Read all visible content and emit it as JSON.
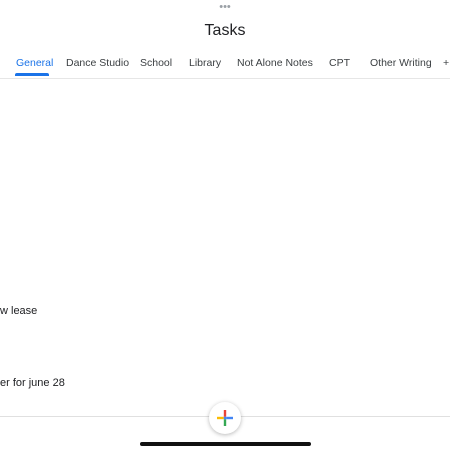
{
  "header": {
    "dots": "•••",
    "title": "Tasks"
  },
  "tabs": [
    {
      "label": "General",
      "active": true
    },
    {
      "label": "Dance Studio",
      "active": false
    },
    {
      "label": "School",
      "active": false
    },
    {
      "label": "Library",
      "active": false
    },
    {
      "label": "Not Alone Notes",
      "active": false
    },
    {
      "label": "CPT",
      "active": false
    },
    {
      "label": "Other Writing",
      "active": false
    },
    {
      "label": "+",
      "active": false
    }
  ],
  "tasks": [
    {
      "text": "w lease"
    },
    {
      "text": "er for june 28"
    }
  ],
  "fab": {
    "icon": "plus-icon",
    "colors": {
      "blue": "#4285F4",
      "red": "#EA4335",
      "yellow": "#FBBC04",
      "green": "#34A853"
    }
  },
  "colors": {
    "accent": "#1a73e8"
  }
}
